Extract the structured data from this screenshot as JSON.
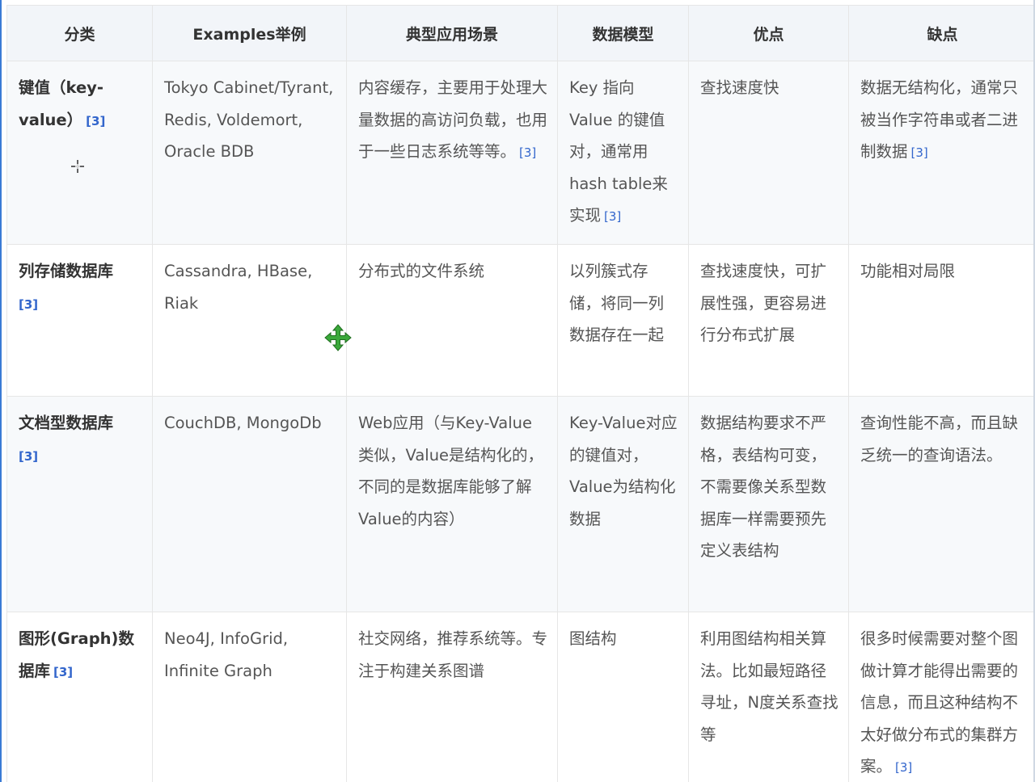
{
  "columns": [
    "分类",
    "Examples举例",
    "典型应用场景",
    "数据模型",
    "优点",
    "缺点"
  ],
  "rows": [
    {
      "category": "键值（key-value）",
      "category_ref": "[3]",
      "examples": "Tokyo Cabinet/Tyrant, Redis, Voldemort, Oracle BDB",
      "scenario": "内容缓存，主要用于处理大量数据的高访问负载，也用于一些日志系统等等。",
      "scenario_ref": "[3]",
      "model": "Key 指向 Value 的键值对，通常用hash table来实现",
      "model_ref": "[3]",
      "pros": "查找速度快",
      "cons": "数据无结构化，通常只被当作字符串或者二进制数据",
      "cons_ref": "[3]"
    },
    {
      "category": "列存储数据库",
      "category_ref": "[3]",
      "examples": "Cassandra, HBase, Riak",
      "scenario": "分布式的文件系统",
      "model": "以列簇式存储，将同一列数据存在一起",
      "pros": "查找速度快，可扩展性强，更容易进行分布式扩展",
      "cons": "功能相对局限"
    },
    {
      "category": "文档型数据库",
      "category_ref": "[3]",
      "examples": "CouchDB, MongoDb",
      "scenario": "Web应用（与Key-Value类似，Value是结构化的，不同的是数据库能够了解Value的内容）",
      "model": "Key-Value对应的键值对，Value为结构化数据",
      "pros": "数据结构要求不严格，表结构可变，不需要像关系型数据库一样需要预先定义表结构",
      "cons": "查询性能不高，而且缺乏统一的查询语法。"
    },
    {
      "category": "图形(Graph)数据库",
      "category_ref": "[3]",
      "examples": "Neo4J, InfoGrid, Infinite Graph",
      "scenario": "社交网络，推荐系统等。专注于构建关系图谱",
      "model": "图结构",
      "pros": "利用图结构相关算法。比如最短路径寻址，N度关系查找等",
      "cons": "很多时候需要对整个图做计算才能得出需要的信息，而且这种结构不太好做分布式的集群方案。",
      "cons_ref": "[3]"
    }
  ],
  "icons": {
    "crosshair": "crosshair-cursor-icon",
    "move": "move-cursor-icon"
  },
  "colors": {
    "header_bg": "#f2f5f9",
    "stripe_bg": "#f7f9fb",
    "ref_link": "#3366cc",
    "move_cursor": "#3aa83a"
  }
}
